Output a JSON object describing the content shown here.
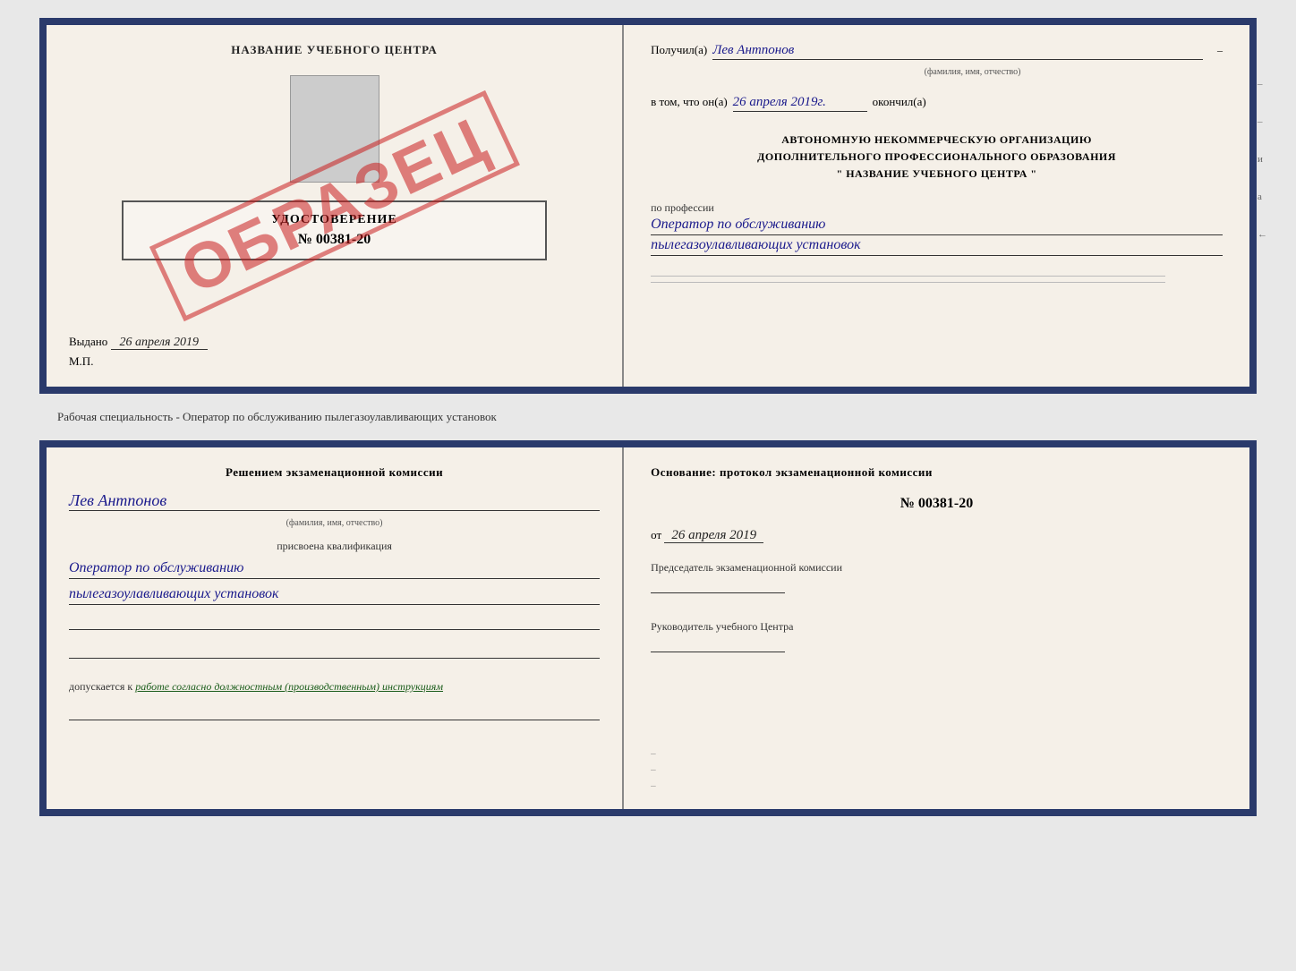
{
  "top_doc": {
    "left": {
      "title": "НАЗВАНИЕ УЧЕБНОГО ЦЕНТРА",
      "stamp_text": "ОБРАЗЕЦ",
      "cert_title": "УДОСТОВЕРЕНИЕ",
      "cert_number": "№ 00381-20",
      "issued_label": "Выдано",
      "issued_date": "26 апреля 2019",
      "mp_label": "М.П."
    },
    "right": {
      "received_label": "Получил(а)",
      "received_name": "Лев Антпонов",
      "fio_sub": "(фамилия, имя, отчество)",
      "fact_label": "в том, что он(а)",
      "fact_date": "26 апреля 2019г.",
      "fact_suffix": "окончил(а)",
      "org_line1": "АВТОНОМНУЮ НЕКОММЕРЧЕСКУЮ ОРГАНИЗАЦИЮ",
      "org_line2": "ДОПОЛНИТЕЛЬНОГО ПРОФЕССИОНАЛЬНОГО ОБРАЗОВАНИЯ",
      "org_quote": "\" НАЗВАНИЕ УЧЕБНОГО ЦЕНТРА \"",
      "profession_label": "по профессии",
      "profession_line1": "Оператор по обслуживанию",
      "profession_line2": "пылегазоулавливающих установок"
    }
  },
  "between_label": "Рабочая специальность - Оператор по обслуживанию пылегазоулавливающих установок",
  "bottom_doc": {
    "left": {
      "decision_text": "Решением экзаменационной комиссии",
      "person_name": "Лев Антпонов",
      "fio_sub": "(фамилия, имя, отчество)",
      "qualification_label": "присвоена квалификация",
      "qualification_line1": "Оператор по обслуживанию",
      "qualification_line2": "пылегазоулавливающих установок",
      "admit_label": "допускается к",
      "admit_value": "работе согласно должностным (производственным) инструкциям"
    },
    "right": {
      "basis_label": "Основание: протокол экзаменационной комиссии",
      "protocol_number": "№ 00381-20",
      "protocol_date_prefix": "от",
      "protocol_date": "26 апреля 2019",
      "chairman_label": "Председатель экзаменационной комиссии",
      "director_label": "Руководитель учебного Центра"
    }
  },
  "side_marks": [
    "и",
    "а",
    "←"
  ]
}
